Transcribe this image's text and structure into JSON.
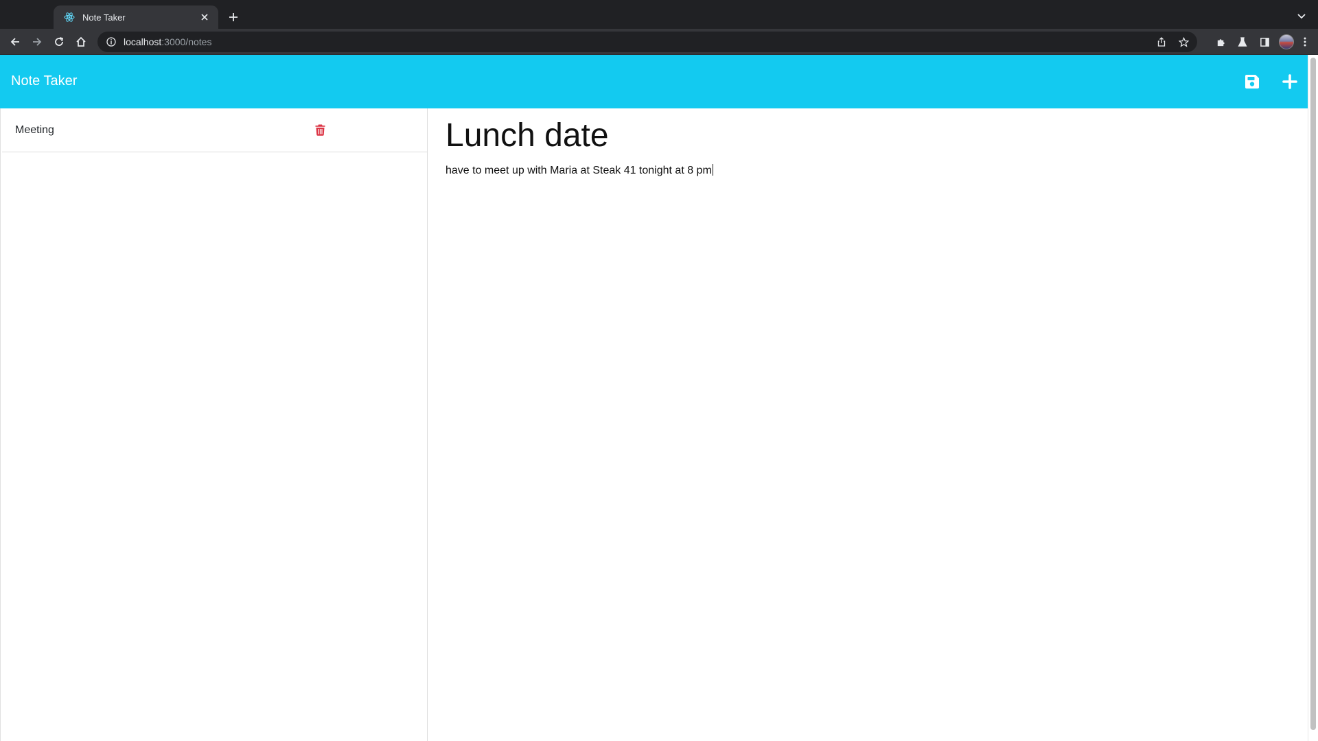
{
  "browser": {
    "tab_title": "Note Taker",
    "url_host": "localhost",
    "url_path": ":3000/notes"
  },
  "navbar": {
    "brand": "Note Taker",
    "color": "#13caf0"
  },
  "sidebar": {
    "notes": [
      {
        "label": "Meeting"
      }
    ],
    "delete_color": "#dc3545"
  },
  "editor": {
    "title": "Lunch date",
    "body": "have to meet up with Maria at Steak 41 tonight at 8 pm"
  },
  "icons": {
    "save": "save-icon",
    "add": "plus-icon",
    "delete": "trash-icon"
  }
}
